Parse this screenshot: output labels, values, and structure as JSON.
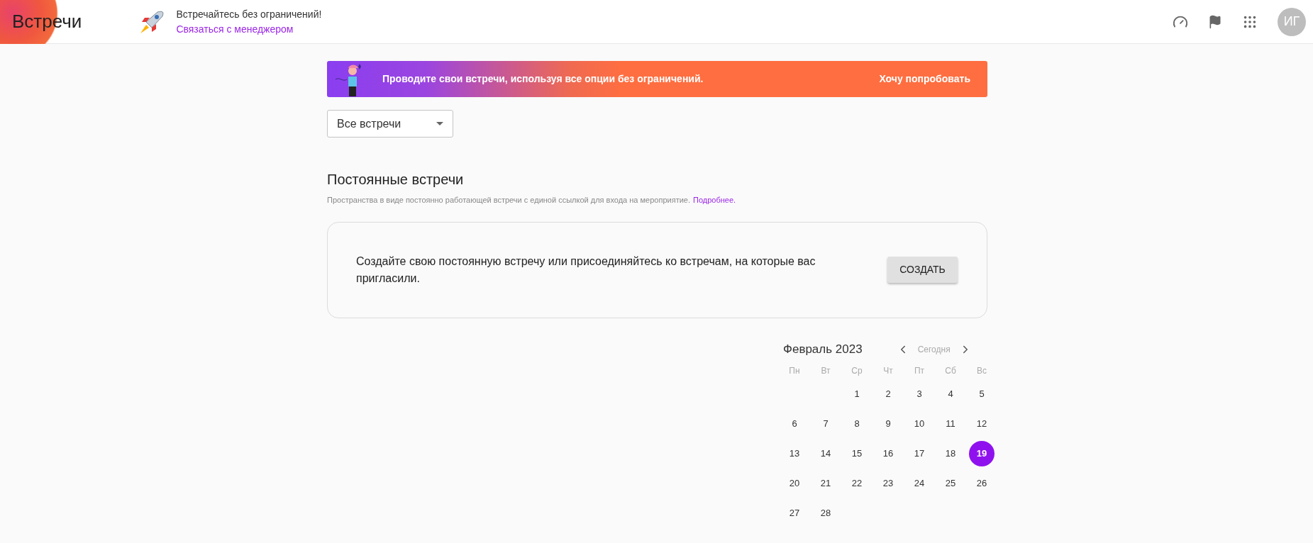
{
  "header": {
    "title": "Встречи",
    "promo_title": "Встречайтесь без ограничений!",
    "promo_link": "Связаться с менеджером",
    "avatar": "ИГ"
  },
  "banner": {
    "text": "Проводите свои встречи, используя все опции без ограничений.",
    "action": "Хочу попробовать"
  },
  "filter": {
    "value": "Все встречи"
  },
  "section": {
    "title": "Постоянные встречи",
    "description": "Пространства в виде постоянно работающей встречи с единой ссылкой для входа на мероприятие.",
    "link": "Подробнее."
  },
  "card": {
    "text": "Создайте свою постоянную встречу или присоединяйтесь ко встречам, на которые вас пригласили.",
    "button": "СОЗДАТЬ"
  },
  "calendar": {
    "month": "Февраль 2023",
    "today": "Сегодня",
    "weekdays": [
      "Пн",
      "Вт",
      "Ср",
      "Чт",
      "Пт",
      "Сб",
      "Вс"
    ],
    "weeks": [
      [
        {
          "label": "1",
          "selected": false
        },
        {
          "label": "2",
          "selected": false
        },
        {
          "label": "3",
          "selected": false
        },
        {
          "label": "4",
          "selected": false
        },
        {
          "label": "5",
          "selected": false
        }
      ],
      [
        {
          "label": "6",
          "selected": false
        },
        {
          "label": "7",
          "selected": false
        },
        {
          "label": "8",
          "selected": false
        },
        {
          "label": "9",
          "selected": false
        },
        {
          "label": "10",
          "selected": false
        },
        {
          "label": "11",
          "selected": false
        },
        {
          "label": "12",
          "selected": false
        }
      ],
      [
        {
          "label": "13",
          "selected": false
        },
        {
          "label": "14",
          "selected": false
        },
        {
          "label": "15",
          "selected": false
        },
        {
          "label": "16",
          "selected": false
        },
        {
          "label": "17",
          "selected": false
        },
        {
          "label": "18",
          "selected": false
        },
        {
          "label": "19",
          "selected": true
        }
      ],
      [
        {
          "label": "20",
          "selected": false
        },
        {
          "label": "21",
          "selected": false
        },
        {
          "label": "22",
          "selected": false
        },
        {
          "label": "23",
          "selected": false
        },
        {
          "label": "24",
          "selected": false
        },
        {
          "label": "25",
          "selected": false
        },
        {
          "label": "26",
          "selected": false
        }
      ],
      [
        {
          "label": "27",
          "selected": false
        },
        {
          "label": "28",
          "selected": false
        }
      ]
    ]
  }
}
